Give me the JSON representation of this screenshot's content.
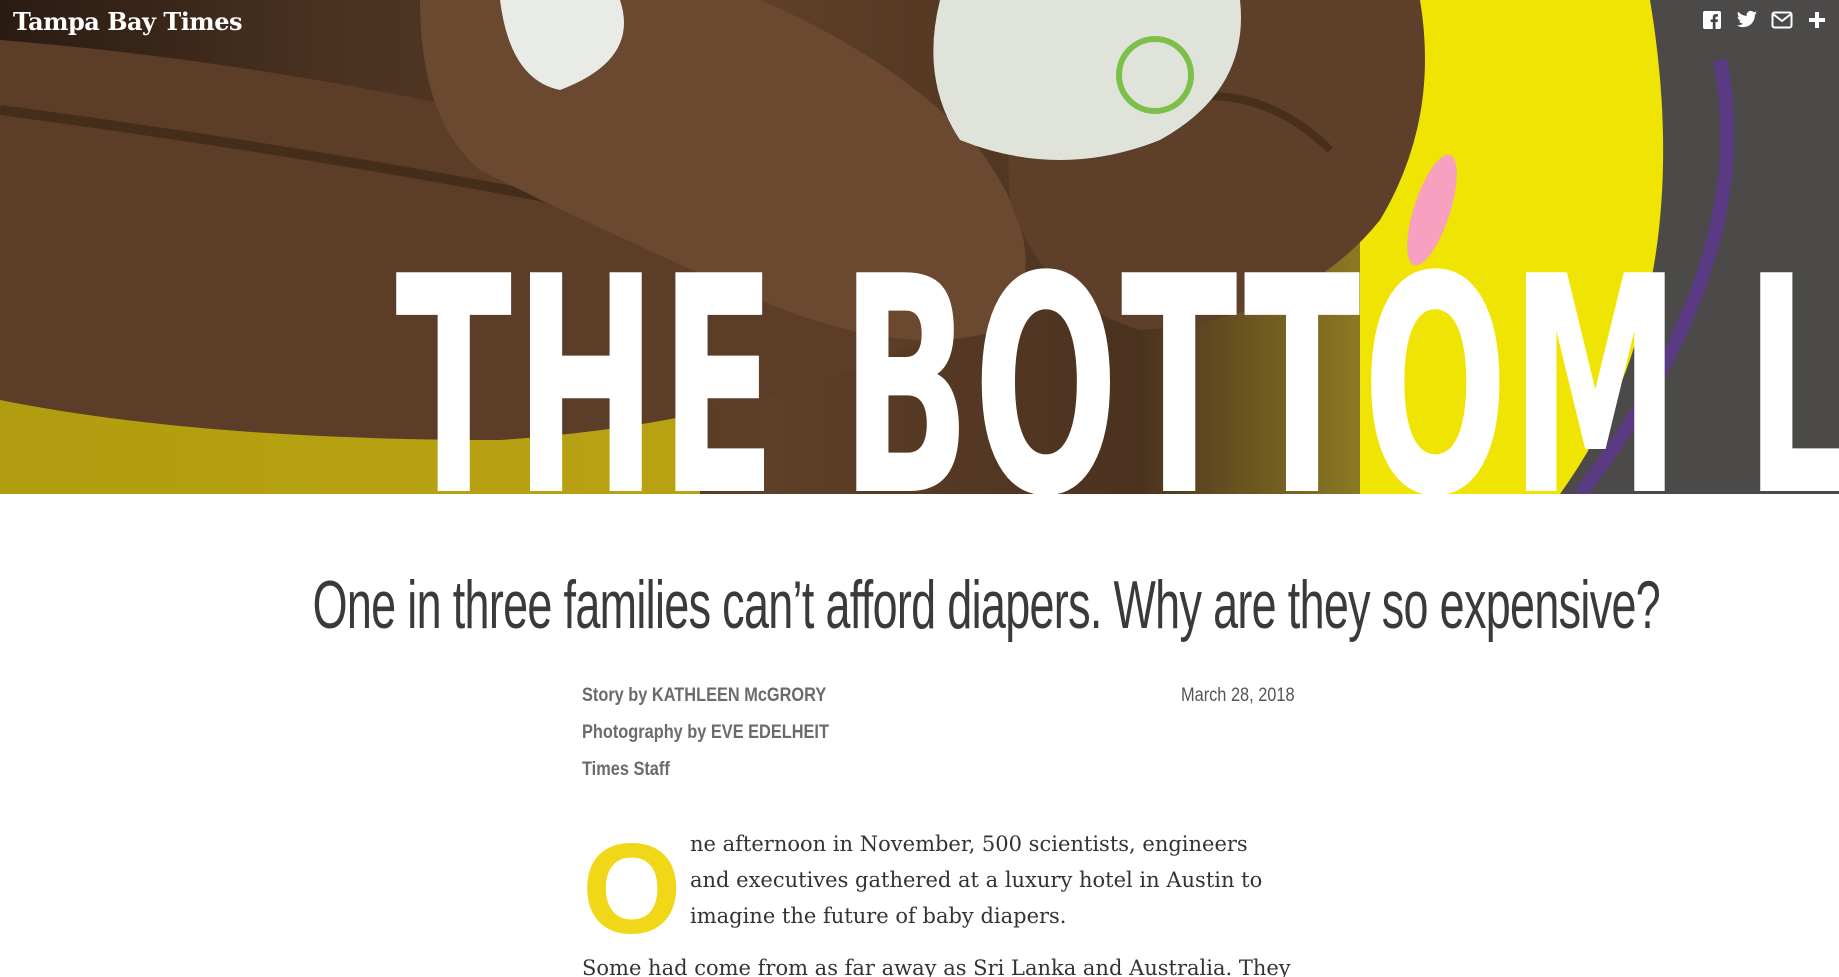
{
  "brand": {
    "name": "Tampa Bay Times"
  },
  "social": [
    {
      "name": "facebook-icon"
    },
    {
      "name": "twitter-icon"
    },
    {
      "name": "email-icon"
    },
    {
      "name": "plus-icon"
    }
  ],
  "hero": {
    "headline": "THE BOTTOM LINE",
    "photo_colors": {
      "skin": "#5a3a24",
      "yellow": "#f0e404",
      "nail": "#f7a0bf"
    }
  },
  "deck": "One in three families can’t afford diapers. Why are they so expensive?",
  "byline": {
    "story": "Story by KATHLEEN McGRORY",
    "photography": "Photography by EVE EDELHEIT",
    "staff": "Times Staff",
    "date": "March 28, 2018"
  },
  "article": {
    "dropcap": "O",
    "lead": "ne afternoon in November, 500 scientists, engineers and executives gathered at a luxury hotel in Austin to imagine the future of baby diapers.",
    "para2": "Some had come from as far away as Sri Lanka and Australia. They"
  },
  "colors": {
    "accent": "#f0d718",
    "text": "#333333"
  }
}
